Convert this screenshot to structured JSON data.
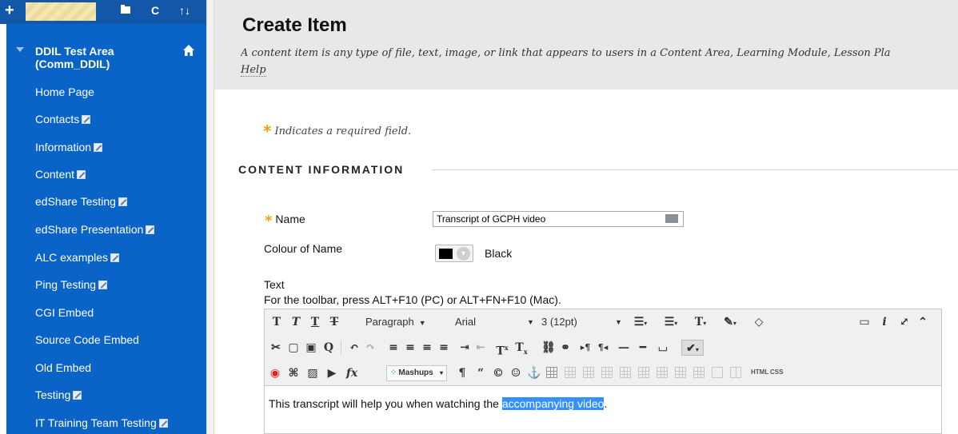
{
  "sidebar": {
    "course_title": "DDIL Test Area (Comm_DDIL)",
    "items": [
      {
        "label": "Home Page",
        "badge": false
      },
      {
        "label": "Contacts",
        "badge": true
      },
      {
        "label": "Information",
        "badge": true
      },
      {
        "label": "Content",
        "badge": true
      },
      {
        "label": "edShare Testing",
        "badge": true
      },
      {
        "label": "edShare Presentation",
        "badge": true
      },
      {
        "label": "ALC examples",
        "badge": true
      },
      {
        "label": "Ping Testing",
        "badge": true
      },
      {
        "label": "CGI Embed",
        "badge": false
      },
      {
        "label": "Source Code Embed",
        "badge": false
      },
      {
        "label": "Old Embed",
        "badge": false
      },
      {
        "label": "Testing",
        "badge": true
      },
      {
        "label": "IT Training Team Testing",
        "badge": true
      }
    ],
    "colors": {
      "nav_bg": "#0a64c8",
      "top_bar": "#1257a8"
    }
  },
  "header": {
    "title": "Create Item",
    "description": "A content item is any type of file, text, image, or link that appears to users in a Content Area, Learning Module, Lesson Pla",
    "help_link": "Help"
  },
  "form": {
    "required_note": "Indicates a required field.",
    "section_title": "CONTENT INFORMATION",
    "name_label": "Name",
    "name_value": "Transcript of GCPH video",
    "colour_label": "Colour of Name",
    "colour_value": "Black",
    "text_label": "Text",
    "toolbar_hint": "For the toolbar, press ALT+F10 (PC) or ALT+FN+F10 (Mac)."
  },
  "editor": {
    "paragraph_format": "Paragraph",
    "font_family": "Arial",
    "font_size": "3 (12pt)",
    "mashups_label": "Mashups",
    "html_label": "HTML",
    "css_label": "CSS",
    "content_prefix": "This transcript will help you when watching the ",
    "content_selected": "accompanying video",
    "content_suffix": "."
  }
}
